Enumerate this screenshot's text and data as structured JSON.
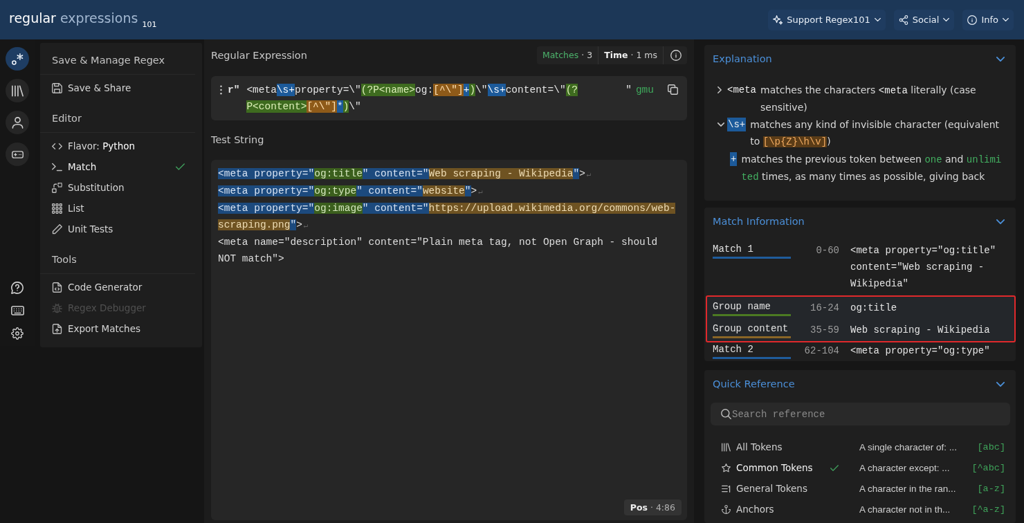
{
  "header": {
    "logo": {
      "primary": "regular",
      "secondary": "expressions",
      "suffix": "101"
    },
    "menus": [
      {
        "label": "Support Regex101"
      },
      {
        "label": "Social"
      },
      {
        "label": "Info"
      }
    ]
  },
  "rail": {
    "items": [
      {
        "selected": true
      },
      {
        "selected": false
      },
      {
        "selected": false
      },
      {
        "selected": false
      }
    ]
  },
  "sidebar": {
    "sections": [
      {
        "title": "Save & Manage Regex",
        "items": [
          {
            "label": "Save & Share"
          }
        ]
      },
      {
        "title": "Editor",
        "items": [
          {
            "label": "Flavor: **Python**",
            "selected": false
          },
          {
            "label": "Match",
            "selected": true
          },
          {
            "label": "Substitution",
            "selected": false
          },
          {
            "label": "List",
            "selected": false
          },
          {
            "label": "Unit Tests",
            "selected": false
          }
        ]
      },
      {
        "title": "Tools",
        "items": [
          {
            "label": "Code Generator",
            "disabled": false
          },
          {
            "label": "Regex Debugger",
            "disabled": true
          },
          {
            "label": "Export Matches",
            "disabled": false
          }
        ]
      }
    ]
  },
  "editor": {
    "regex_heading": "Regular Expression",
    "stats": [
      {
        "kind": "matches",
        "label": "Matches",
        "value": "· 3"
      },
      {
        "kind": "time",
        "label": "Time",
        "value": "· 1 ms"
      }
    ],
    "regex": {
      "delimiter_open": "r\"",
      "tokens": [
        {
          "kind": "literal",
          "text": "<meta"
        },
        {
          "kind": "quantifier",
          "text": "\\s+"
        },
        {
          "kind": "literal",
          "text": "property=\\\""
        },
        {
          "kind": "group",
          "text": "(?P<name>"
        },
        {
          "kind": "literal",
          "text": "og:"
        },
        {
          "kind": "class",
          "text": "[^\\\"]"
        },
        {
          "kind": "quantifier",
          "text": "+"
        },
        {
          "kind": "group",
          "text": ")"
        },
        {
          "kind": "literal",
          "text": "\\\""
        },
        {
          "kind": "quantifier",
          "text": "\\s+"
        },
        {
          "kind": "literal",
          "text": "content=\\\""
        },
        {
          "kind": "group",
          "text": "(?P<content>"
        },
        {
          "kind": "class",
          "text": "[^\\\"]"
        },
        {
          "kind": "quantifier",
          "text": "*"
        },
        {
          "kind": "group",
          "text": ")"
        },
        {
          "kind": "literal",
          "text": "\\\""
        }
      ],
      "delimiter_close": "\"",
      "flags": "gmu"
    },
    "test_heading": "Test String",
    "test_lines": [
      {
        "segments": [
          {
            "kind": "match",
            "text": "<meta property=\""
          },
          {
            "kind": "group_name",
            "text": "og:title"
          },
          {
            "kind": "match",
            "text": "\" content=\""
          },
          {
            "kind": "group_content",
            "text": "Web scraping - Wikipedia"
          },
          {
            "kind": "match",
            "text": "\""
          },
          {
            "kind": "plain",
            "text": ">"
          },
          {
            "kind": "newline",
            "text": "↵"
          }
        ]
      },
      {
        "segments": [
          {
            "kind": "match",
            "text": "<meta property=\""
          },
          {
            "kind": "group_name",
            "text": "og:type"
          },
          {
            "kind": "match",
            "text": "\" content=\""
          },
          {
            "kind": "group_content",
            "text": "website"
          },
          {
            "kind": "match",
            "text": "\""
          },
          {
            "kind": "plain",
            "text": ">"
          },
          {
            "kind": "newline",
            "text": "↵"
          }
        ]
      },
      {
        "segments": [
          {
            "kind": "match",
            "text": "<meta property=\""
          },
          {
            "kind": "group_name",
            "text": "og:image"
          },
          {
            "kind": "match",
            "text": "\" content=\""
          },
          {
            "kind": "group_content",
            "text": "https://upload.wikimedia.org/commons/web-scraping.png"
          },
          {
            "kind": "match",
            "text": "\""
          },
          {
            "kind": "plain",
            "text": ">"
          },
          {
            "kind": "newline",
            "text": "↵"
          }
        ]
      },
      {
        "segments": [
          {
            "kind": "plain",
            "text": "<meta name=\"description\" content=\"Plain meta tag, not Open Graph - should NOT match\">"
          }
        ]
      }
    ],
    "position": "**Pos** · 4:86"
  },
  "explanation": {
    "title": "Explanation",
    "expanded": true,
    "entries": [
      {
        "expanded": false,
        "token": {
          "kind": "literal",
          "text": "<meta"
        },
        "description": [
          {
            "kind": "text",
            "text": "matches the characters "
          },
          {
            "kind": "code",
            "text": "<meta"
          },
          {
            "kind": "text",
            "text": " literally (case sensitive)"
          }
        ]
      },
      {
        "expanded": true,
        "token": {
          "kind": "quantifier",
          "text": "\\s+"
        },
        "description": [
          {
            "kind": "text",
            "text": "matches any kind of invisible character (equivalent to "
          },
          {
            "kind": "class",
            "text": "[\\p{Z}\\h\\v]"
          },
          {
            "kind": "text",
            "text": ")"
          }
        ],
        "children": [
          {
            "token": {
              "kind": "quantifier",
              "text": "+"
            },
            "description": [
              {
                "kind": "text",
                "text": "matches the previous token between "
              },
              {
                "kind": "count",
                "text": "one"
              },
              {
                "kind": "text",
                "text": " and "
              },
              {
                "kind": "count",
                "text": "unlimited"
              },
              {
                "kind": "text",
                "text": " times, as many times as possible, giving back"
              }
            ]
          }
        ]
      }
    ]
  },
  "match_information": {
    "title": "Match Information",
    "expanded": true,
    "rows": [
      {
        "label": "Match 1",
        "range": "0-60",
        "value": "<meta property=\"og:title\" content=\"Web scraping - Wikipedia\"",
        "color": "#1f5c9c",
        "highlighted": false
      },
      {
        "label": "Group name",
        "range": "16-24",
        "value": "og:title",
        "color": "#4c7a22",
        "highlighted": true
      },
      {
        "label": "Group content",
        "range": "35-59",
        "value": "Web scraping - Wikipedia",
        "color": "#8a6526",
        "highlighted": true
      },
      {
        "label": "Match 2",
        "range": "62-104",
        "value": "<meta property=\"og:type\"",
        "color": "#1f5c9c",
        "highlighted": false
      }
    ]
  },
  "quick_reference": {
    "title": "Quick Reference",
    "expanded": true,
    "search": {
      "placeholder": "Search reference"
    },
    "categories": [
      {
        "label": "All Tokens",
        "selected": false
      },
      {
        "label": "Common Tokens",
        "selected": true
      },
      {
        "label": "General Tokens",
        "selected": false
      },
      {
        "label": "Anchors",
        "selected": false
      }
    ],
    "tokens": [
      {
        "description": "A single character of: ...",
        "syntax": "[abc]"
      },
      {
        "description": "A character except: ...",
        "syntax": "[^abc]"
      },
      {
        "description": "A character in the ran...",
        "syntax": "[a-z]"
      },
      {
        "description": "A character not in th...",
        "syntax": "[^a-z]"
      }
    ]
  }
}
